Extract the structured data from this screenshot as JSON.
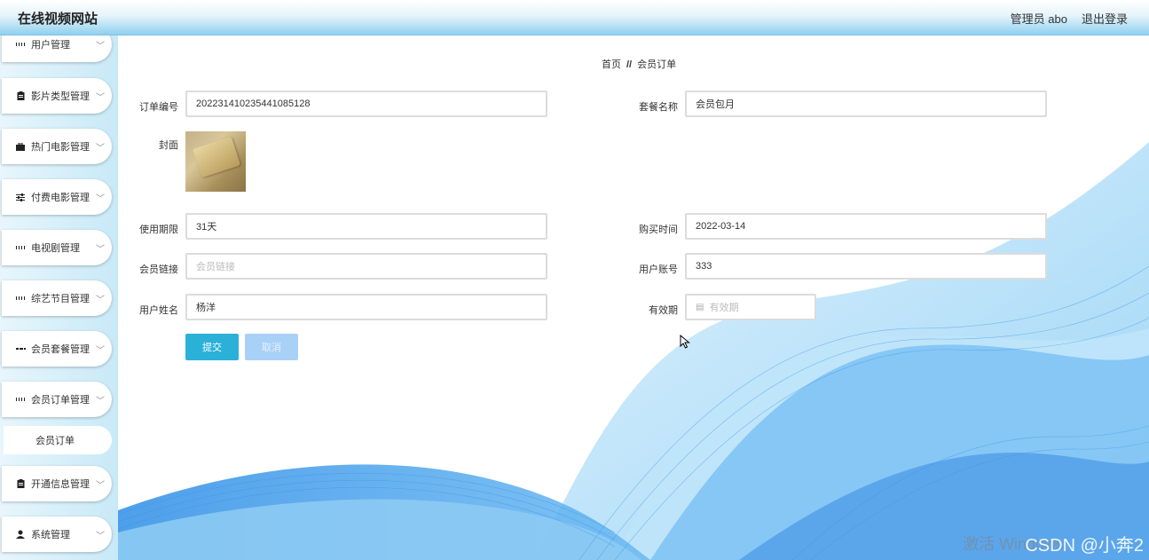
{
  "header": {
    "site_title": "在线视频网站",
    "admin_label": "管理员 abo",
    "logout_label": "退出登录"
  },
  "sidebar": {
    "items": [
      {
        "label": "用户管理",
        "icon": "grid-icon"
      },
      {
        "label": "影片类型管理",
        "icon": "clipboard-icon"
      },
      {
        "label": "热门电影管理",
        "icon": "briefcase-icon"
      },
      {
        "label": "付费电影管理",
        "icon": "sliders-icon"
      },
      {
        "label": "电视剧管理",
        "icon": "grid-icon"
      },
      {
        "label": "综艺节目管理",
        "icon": "grid-icon"
      },
      {
        "label": "会员套餐管理",
        "icon": "grid9-icon"
      },
      {
        "label": "会员订单管理",
        "icon": "grid-icon"
      },
      {
        "label": "开通信息管理",
        "icon": "clipboard-icon"
      },
      {
        "label": "系统管理",
        "icon": "user-icon"
      }
    ],
    "submenu": {
      "label": "会员订单"
    }
  },
  "breadcrumb": {
    "home": "首页",
    "separator": "//",
    "current": "会员订单"
  },
  "form": {
    "order_no": {
      "label": "订单编号",
      "value": "202231410235441085128"
    },
    "package_name": {
      "label": "套餐名称",
      "value": "会员包月"
    },
    "cover": {
      "label": "封面"
    },
    "duration": {
      "label": "使用期限",
      "value": "31天"
    },
    "purchase_time": {
      "label": "购买时间",
      "value": "2022-03-14"
    },
    "member_link": {
      "label": "会员链接",
      "placeholder": "会员链接"
    },
    "user_account": {
      "label": "用户账号",
      "value": "333"
    },
    "user_name": {
      "label": "用户姓名",
      "value": "杨洋"
    },
    "validity": {
      "label": "有效期",
      "placeholder": "有效期"
    },
    "submit_label": "提交",
    "cancel_label": "取消"
  },
  "watermark": {
    "activate": "激活 Windows",
    "csdn": "CSDN @小奔2"
  },
  "colors": {
    "accent": "#2bb0d8",
    "wave_dark": "#1a7fe0",
    "wave_light": "#9ad3f7",
    "sidebar_bg": "#c8e9f7"
  }
}
